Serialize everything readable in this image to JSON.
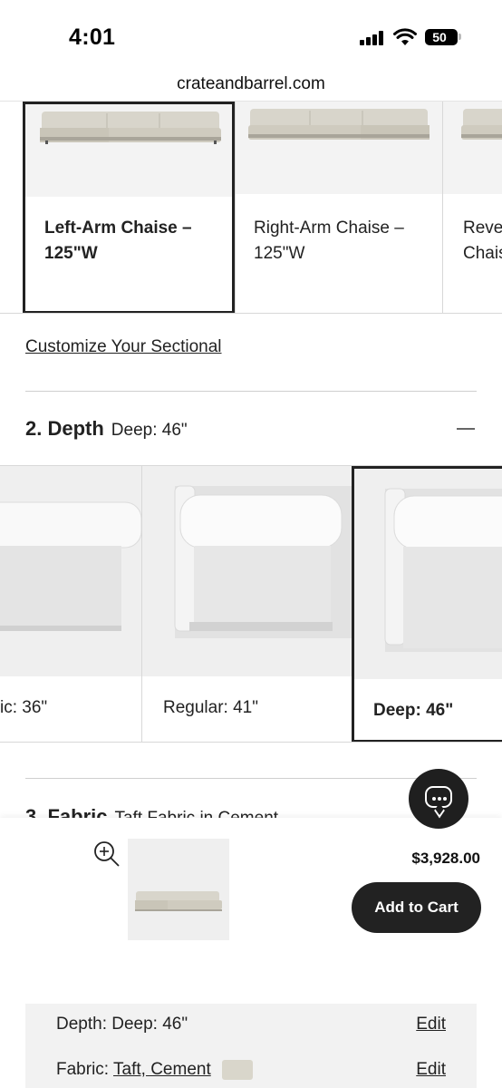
{
  "status_bar": {
    "time": "4:01",
    "battery": "50"
  },
  "browser": {
    "url": "crateandbarrel.com"
  },
  "configuration": {
    "options": [
      {
        "label": "Left-Arm Chaise – 125\"W",
        "selected": true
      },
      {
        "label": "Right-Arm Chaise – 125\"W",
        "selected": false
      },
      {
        "label": "Reve Chais",
        "selected": false
      }
    ],
    "customize_link": "Customize Your Sectional"
  },
  "depth": {
    "title": "2. Depth",
    "selected_value": "Deep: 46\"",
    "options": [
      {
        "label": "ic: 36\"",
        "selected": false
      },
      {
        "label": "Regular: 41\"",
        "selected": false
      },
      {
        "label": "Deep: 46\"",
        "selected": true
      }
    ]
  },
  "fabric": {
    "title": "3. Fabric",
    "selected_value": "Taft Fabric in Cement"
  },
  "cart": {
    "price": "$3,928.00",
    "add_to_cart_label": "Add to Cart"
  },
  "summary": {
    "depth_label": "Depth: Deep: 46\"",
    "fabric_prefix": "Fabric: ",
    "fabric_value": "Taft, Cement",
    "edit_label": "Edit"
  },
  "colors": {
    "text": "#222222",
    "button_bg": "#222222",
    "card_bg": "#f3f3f3",
    "summary_bg": "#f2f2f2"
  }
}
